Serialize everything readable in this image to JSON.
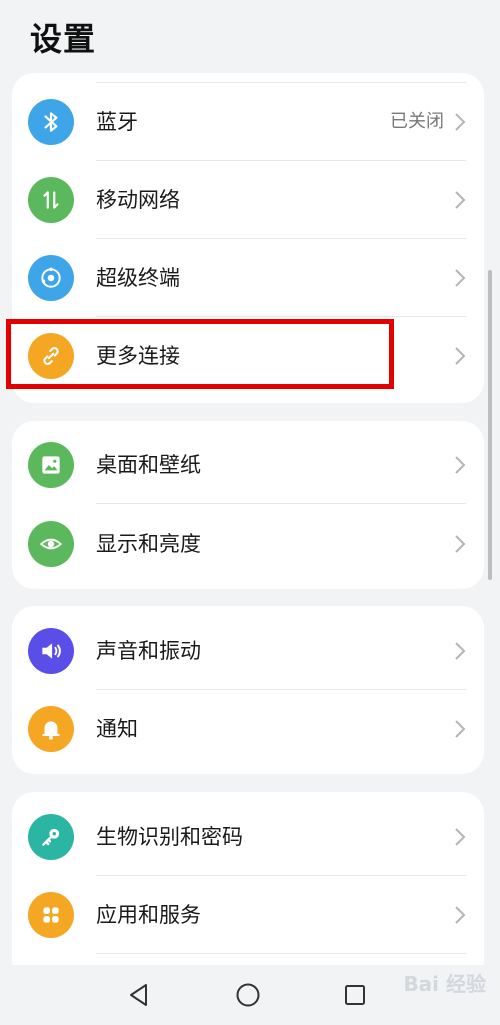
{
  "page": {
    "title": "设置"
  },
  "groups": [
    {
      "items": [
        {
          "label": "蓝牙",
          "value": "已关闭",
          "icon": "bluetooth-icon",
          "color": "#3ea6e8"
        },
        {
          "label": "移动网络",
          "icon": "mobile-data-icon",
          "color": "#5cb85c"
        },
        {
          "label": "超级终端",
          "icon": "super-device-icon",
          "color": "#3ea6e8"
        },
        {
          "label": "更多连接",
          "icon": "link-icon",
          "color": "#f5a623"
        }
      ]
    },
    {
      "items": [
        {
          "label": "桌面和壁纸",
          "icon": "wallpaper-icon",
          "color": "#5cb85c"
        },
        {
          "label": "显示和亮度",
          "icon": "eye-icon",
          "color": "#5cb85c"
        }
      ]
    },
    {
      "items": [
        {
          "label": "声音和振动",
          "icon": "speaker-icon",
          "color": "#5b4ee8"
        },
        {
          "label": "通知",
          "icon": "bell-icon",
          "color": "#f5a623"
        }
      ]
    },
    {
      "items": [
        {
          "label": "生物识别和密码",
          "icon": "key-icon",
          "color": "#2bb5a3"
        },
        {
          "label": "应用和服务",
          "icon": "apps-icon",
          "color": "#f5a623"
        }
      ]
    }
  ],
  "navbar": {
    "back_icon": "back-triangle-icon",
    "home_icon": "home-circle-icon",
    "recents_icon": "recents-square-icon"
  },
  "watermark": {
    "text": "Bai 经验"
  }
}
